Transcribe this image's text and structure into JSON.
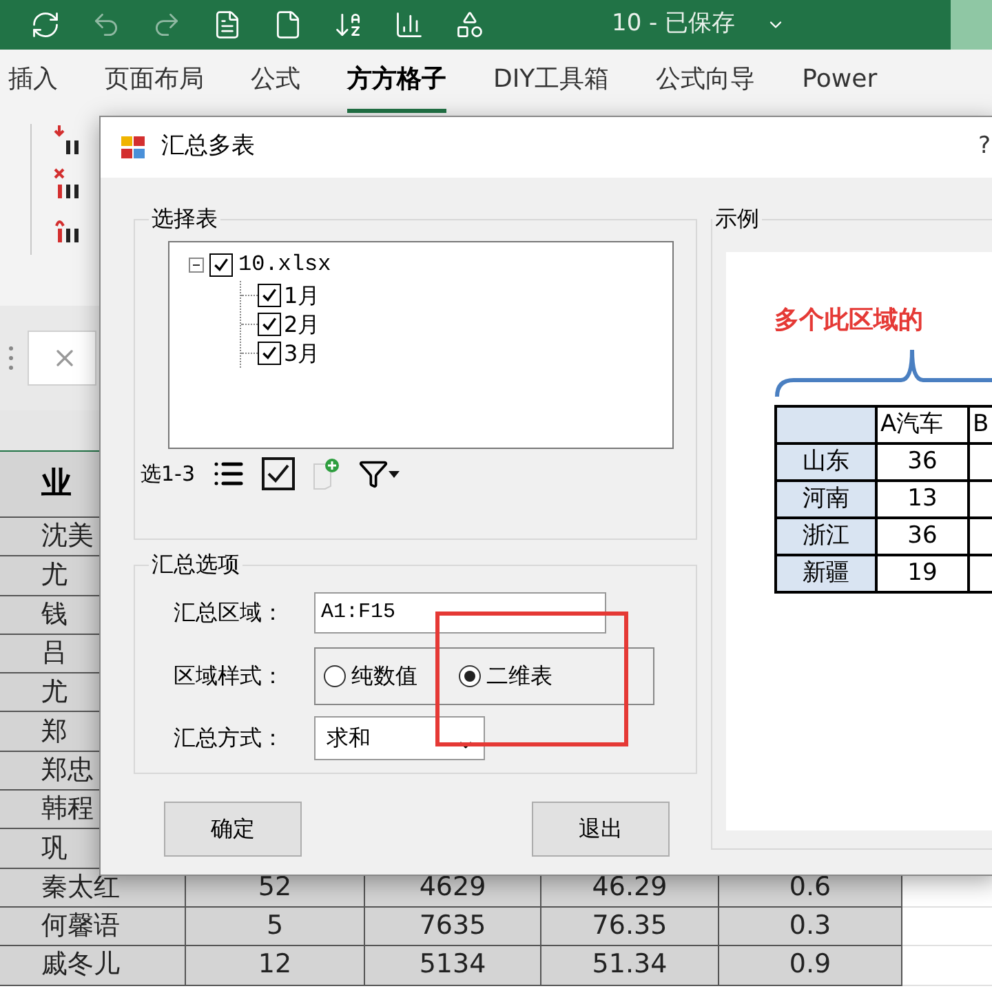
{
  "title_bar": {
    "document_status": "10 - 已保存"
  },
  "ribbon_tabs": [
    {
      "label": "插入",
      "selected": false
    },
    {
      "label": "页面布局",
      "selected": false
    },
    {
      "label": "公式",
      "selected": false
    },
    {
      "label": "方方格子",
      "selected": true
    },
    {
      "label": "DIY工具箱",
      "selected": false
    },
    {
      "label": "公式向导",
      "selected": false
    },
    {
      "label": "Power",
      "selected": false
    }
  ],
  "sheet": {
    "header_cell": "业",
    "rows": [
      {
        "cells": [
          "沈美"
        ]
      },
      {
        "cells": [
          "尤"
        ]
      },
      {
        "cells": [
          "钱"
        ]
      },
      {
        "cells": [
          "吕"
        ]
      },
      {
        "cells": [
          "尤"
        ]
      },
      {
        "cells": [
          "郑"
        ]
      },
      {
        "cells": [
          "郑忠"
        ]
      },
      {
        "cells": [
          "韩程"
        ]
      },
      {
        "cells": [
          "巩"
        ]
      },
      {
        "cells": [
          "秦太红",
          "52",
          "4629",
          "46.29",
          "0.6"
        ]
      },
      {
        "cells": [
          "何馨语",
          "5",
          "7635",
          "76.35",
          "0.3"
        ]
      },
      {
        "cells": [
          "戚冬儿",
          "12",
          "5134",
          "51.34",
          "0.9"
        ]
      }
    ]
  },
  "dialog": {
    "title": "汇总多表",
    "help": "?",
    "select_group": {
      "title": "选择表",
      "tree": {
        "label": "10.xlsx",
        "checked": true,
        "expanded": true,
        "children": [
          {
            "label": "1月",
            "checked": true
          },
          {
            "label": "2月",
            "checked": true
          },
          {
            "label": "3月",
            "checked": true
          }
        ]
      },
      "toolbar_label": "选1-3"
    },
    "options_group": {
      "title": "汇总选项",
      "range_label": "汇总区域：",
      "range_value": "A1:F15",
      "style_label": "区域样式：",
      "style_options": [
        {
          "label": "纯数值",
          "selected": false
        },
        {
          "label": "二维表",
          "selected": true
        }
      ],
      "method_label": "汇总方式：",
      "method_value": "求和"
    },
    "buttons": [
      "确定",
      "退出"
    ],
    "example": {
      "title": "示例",
      "caption": "多个此区域的",
      "columns": [
        "",
        "A汽车",
        "B"
      ],
      "rows": [
        [
          "山东",
          "36"
        ],
        [
          "河南",
          "13"
        ],
        [
          "浙江",
          "36"
        ],
        [
          "新疆",
          "19"
        ]
      ]
    }
  }
}
